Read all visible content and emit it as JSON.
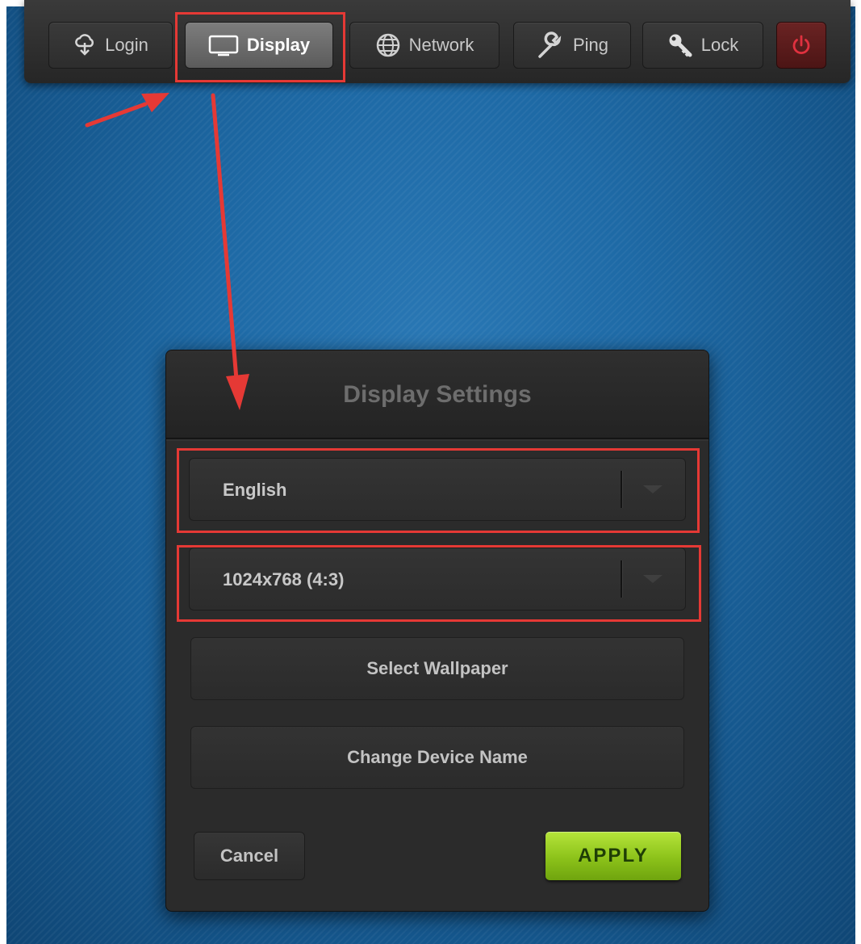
{
  "toolbar": {
    "login_label": "Login",
    "display_label": "Display",
    "network_label": "Network",
    "ping_label": "Ping",
    "lock_label": "Lock",
    "icons": {
      "login": "cloud-download-icon",
      "display": "monitor-icon",
      "network": "globe-icon",
      "ping": "wrench-icon",
      "lock": "key-icon",
      "power": "power-icon"
    }
  },
  "dialog": {
    "title": "Display Settings",
    "language_value": "English",
    "resolution_value": "1024x768 (4:3)",
    "select_wallpaper_label": "Select Wallpaper",
    "change_device_name_label": "Change Device Name",
    "cancel_label": "Cancel",
    "apply_label": "APPLY"
  },
  "colors": {
    "accent_green": "#8cc21a",
    "highlight_red": "#e53935",
    "power_red": "#e0313f",
    "desktop_blue": "#1e6aa6"
  }
}
